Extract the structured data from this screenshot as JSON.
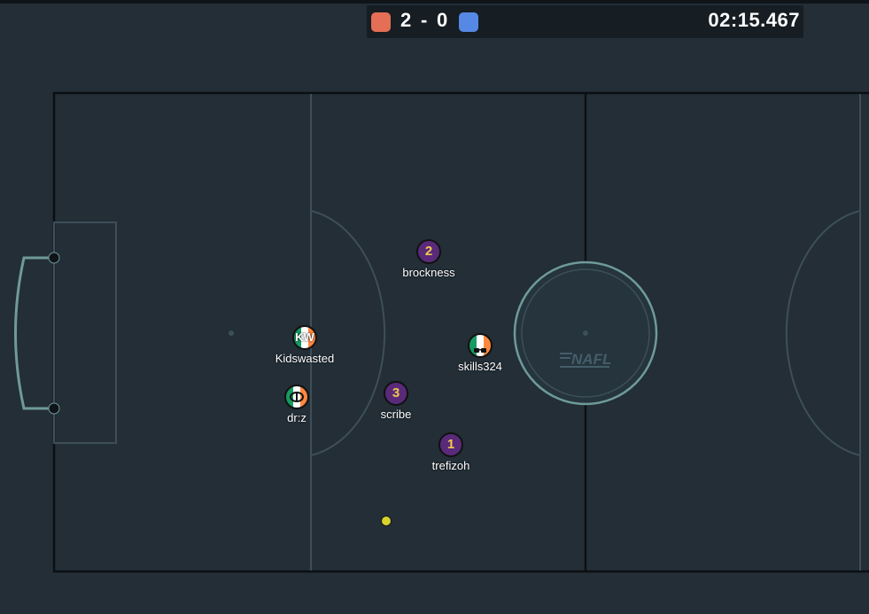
{
  "scoreboard": {
    "red_score": "2",
    "separator": "-",
    "blue_score": "0",
    "timer": "02:15.467",
    "red_color": "#e56e56",
    "blue_color": "#5689e5"
  },
  "field": {
    "logo_text": "NAFL",
    "pitch_color": "#232e37",
    "line_color": "#3d4f59"
  },
  "players": [
    {
      "id": "brockness",
      "name": "brockness",
      "number": "2",
      "team": "blue"
    },
    {
      "id": "kidswasted",
      "name": "Kidswasted",
      "avatar": "KW",
      "team": "red"
    },
    {
      "id": "skills324",
      "name": "skills324",
      "avatar": "",
      "team": "red"
    },
    {
      "id": "drz",
      "name": "dr:z",
      "avatar": "",
      "team": "red"
    },
    {
      "id": "scribe",
      "name": "scribe",
      "number": "3",
      "team": "blue"
    },
    {
      "id": "trefizoh",
      "name": "trefizoh",
      "number": "1",
      "team": "blue"
    }
  ]
}
